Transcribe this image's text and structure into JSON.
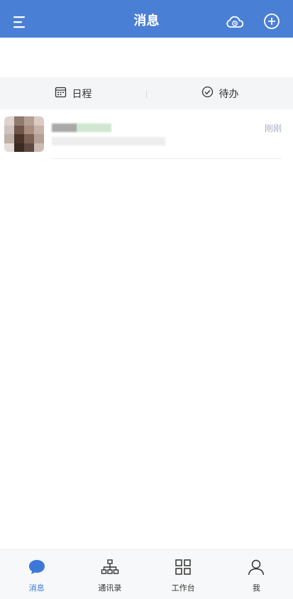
{
  "header": {
    "title": "消息",
    "menu_icon": "menu-icon",
    "cloud_icon": "cloud-clock-icon",
    "add_icon": "plus-circle-icon",
    "bg_color": "#4a7fd6"
  },
  "quick_tabs": [
    {
      "label": "日程",
      "icon": "calendar-icon"
    },
    {
      "label": "待办",
      "icon": "check-circle-icon"
    }
  ],
  "conversations": [
    {
      "time": "刚刚"
    }
  ],
  "tabbar": {
    "active_color": "#3b78d8",
    "items": [
      {
        "label": "消息",
        "icon": "chat-bubble-icon",
        "active": true
      },
      {
        "label": "通讯录",
        "icon": "org-chart-icon",
        "active": false
      },
      {
        "label": "工作台",
        "icon": "grid-icon",
        "active": false
      },
      {
        "label": "我",
        "icon": "person-icon",
        "active": false
      }
    ]
  }
}
